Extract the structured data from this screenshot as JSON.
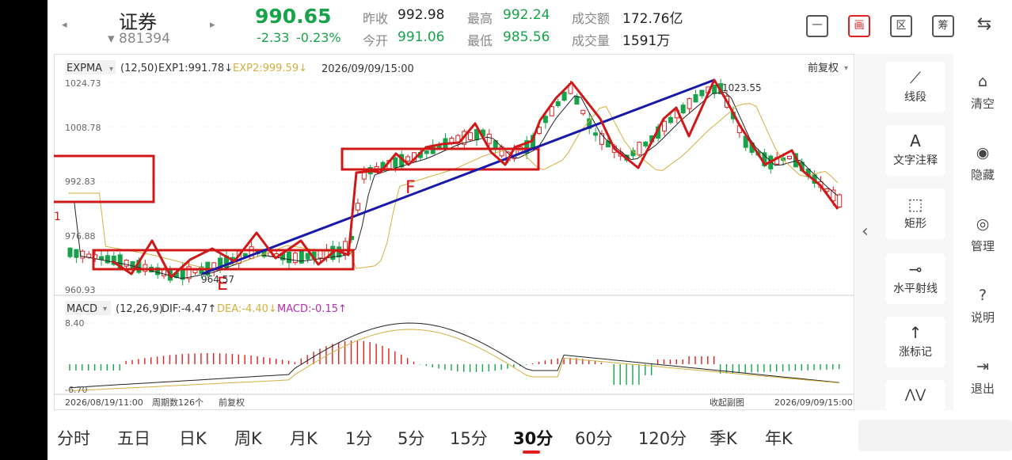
{
  "header": {
    "prev_arrow": "◂",
    "next_arrow": "▸",
    "stock_name": "证券",
    "stock_code": "881394",
    "code_arrow": "▾",
    "price": "990.65",
    "change": "-2.33",
    "change_pct": "-0.23%",
    "prev_close_label": "昨收",
    "prev_close": "992.98",
    "open_label": "今开",
    "open": "991.06",
    "high_label": "最高",
    "high": "992.24",
    "low_label": "最低",
    "low": "985.56",
    "turnover_label": "成交额",
    "turnover": "172.76亿",
    "volume_label": "成交量",
    "volume": "1591万",
    "buttons": [
      "一",
      "画",
      "区",
      "筹",
      "⇆"
    ]
  },
  "chart": {
    "main_indicator": "EXPMA",
    "main_params": "(12,50)",
    "exp1_label": "EXP1:991.78↓",
    "exp2_label": "EXP2:999.59↓",
    "datetime": "2026/09/09/15:00",
    "adjust": "前复权",
    "y_labels": [
      "1024.73",
      "1008.78",
      "992.83",
      "976.88",
      "960.93"
    ],
    "low_mark": "964.57",
    "high_mark": "1023.55",
    "annotation_e": "E",
    "annotation_f": "F",
    "sub_indicator": "MACD",
    "sub_params": "(12,26,9)",
    "dif_label": "DIF:-4.47↑",
    "dea_label": "DEA:-4.40↓",
    "macd_label": "MACD:-0.15↑",
    "macd_top": "8.40",
    "macd_bottom": "-6.70",
    "start_time": "2026/08/19/11:00",
    "period_count": "周期数126个",
    "adjust2": "前复权",
    "collapse": "收起副图",
    "end_time": "2026/09/09/15:00"
  },
  "chart_data": {
    "type": "candlestick",
    "ylim": [
      960.93,
      1024.73
    ],
    "series": [
      {
        "name": "EXP1",
        "values": []
      },
      {
        "name": "EXP2",
        "values": []
      }
    ]
  },
  "tools": [
    {
      "icon": "⟋",
      "label": "线段"
    },
    {
      "icon": "A",
      "label": "文字注释"
    },
    {
      "icon": "⬚",
      "label": "矩形"
    },
    {
      "icon": "⊸",
      "label": "水平射线"
    },
    {
      "icon": "↑",
      "label": "涨标记"
    }
  ],
  "panel_toggle": "‹",
  "side": [
    {
      "icon": "⌂",
      "label": "清空"
    },
    {
      "icon": "◉",
      "label": "隐藏"
    },
    {
      "icon": "◎",
      "label": "管理"
    },
    {
      "icon": "?",
      "label": "说明"
    },
    {
      "icon": "⇥",
      "label": "退出"
    }
  ],
  "periods": [
    "分时",
    "五日",
    "日K",
    "周K",
    "月K",
    "1分",
    "5分",
    "15分",
    "30分",
    "60分",
    "120分",
    "季K",
    "年K"
  ],
  "active_period": "30分",
  "colors": {
    "up": "#e02020",
    "down": "#17a34a",
    "exp2": "#d4b040",
    "line": "#1a1aaa"
  }
}
